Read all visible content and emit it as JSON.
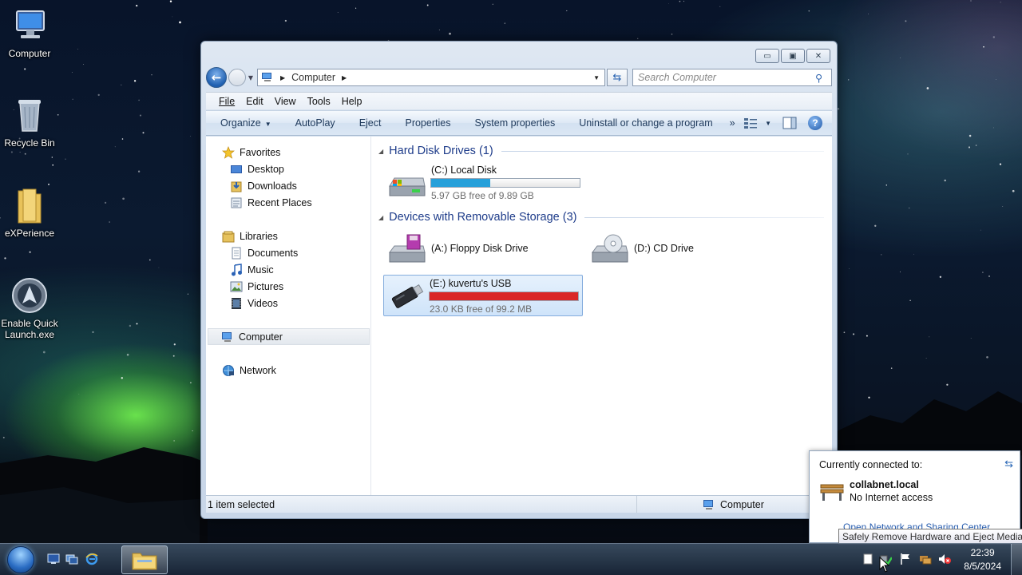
{
  "desktop": {
    "icons": [
      {
        "label": "Computer"
      },
      {
        "label": "Recycle Bin"
      },
      {
        "label": "eXPerience"
      },
      {
        "label": "Enable Quick Launch.exe"
      }
    ]
  },
  "window": {
    "address": {
      "crumb": "Computer"
    },
    "search": {
      "placeholder": "Search Computer"
    },
    "menu": [
      "File",
      "Edit",
      "View",
      "Tools",
      "Help"
    ],
    "toolbar": {
      "organize": "Organize",
      "items": [
        "AutoPlay",
        "Eject",
        "Properties",
        "System properties",
        "Uninstall or change a program"
      ],
      "overflow": "»"
    },
    "navpane": {
      "favorites": "Favorites",
      "fav_items": [
        "Desktop",
        "Downloads",
        "Recent Places"
      ],
      "libraries": "Libraries",
      "lib_items": [
        "Documents",
        "Music",
        "Pictures",
        "Videos"
      ],
      "computer": "Computer",
      "network": "Network"
    },
    "groups": {
      "hdd": "Hard Disk Drives (1)",
      "removable": "Devices with Removable Storage (3)"
    },
    "drives": {
      "c": {
        "name": "(C:) Local Disk",
        "free": "5.97 GB free of 9.89 GB",
        "used_fraction": 0.4,
        "bar_color": "#26a0da"
      },
      "a": {
        "name": "(A:) Floppy Disk Drive"
      },
      "d": {
        "name": "(D:) CD Drive"
      },
      "e": {
        "name": "(E:) kuvertu's USB",
        "free": "23.0 KB free of 99.2 MB",
        "used_fraction": 1.0,
        "bar_color": "#da2626"
      }
    },
    "status": {
      "left": "1 item selected",
      "right": "Computer"
    }
  },
  "network_popup": {
    "header": "Currently connected to:",
    "network_name": "collabnet.local",
    "network_status": "No Internet access",
    "link": "Open Network and Sharing Center"
  },
  "tooltip": "Safely Remove Hardware and Eject Media",
  "clock": {
    "time": "22:39",
    "date": "8/5/2024"
  }
}
